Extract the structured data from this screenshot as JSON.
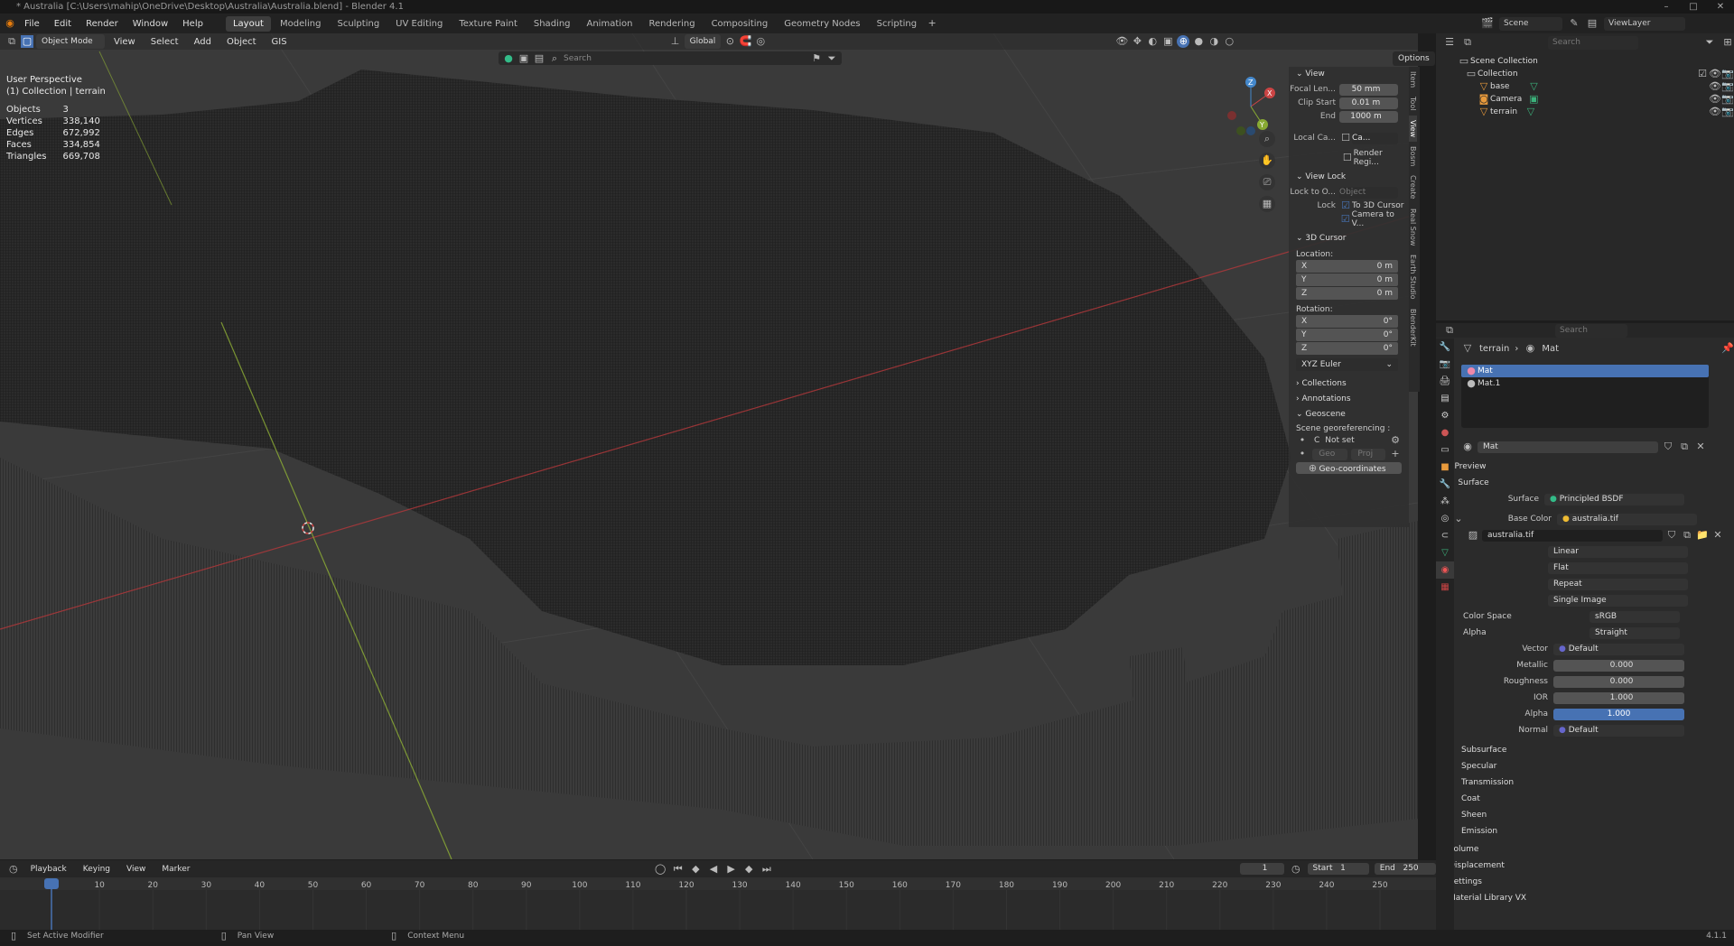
{
  "titlebar": {
    "title": "* Australia [C:\\Users\\mahip\\OneDrive\\Desktop\\Australia\\Australia.blend] - Blender 4.1"
  },
  "menus": [
    "File",
    "Edit",
    "Render",
    "Window",
    "Help"
  ],
  "workspaces": [
    "Layout",
    "Modeling",
    "Sculpting",
    "UV Editing",
    "Texture Paint",
    "Shading",
    "Animation",
    "Rendering",
    "Compositing",
    "Geometry Nodes",
    "Scripting"
  ],
  "topright": {
    "scene": "Scene",
    "viewlayer": "ViewLayer"
  },
  "viewport": {
    "mode": "Object Mode",
    "menus": [
      "View",
      "Select",
      "Add",
      "Object",
      "GIS"
    ],
    "transform": "Global",
    "search_placeholder": "Search",
    "options": "Options",
    "info_line1": "User Perspective",
    "info_line2": "(1) Collection | terrain",
    "stats": [
      {
        "label": "Objects",
        "value": "3"
      },
      {
        "label": "Vertices",
        "value": "338,140"
      },
      {
        "label": "Edges",
        "value": "672,992"
      },
      {
        "label": "Faces",
        "value": "334,854"
      },
      {
        "label": "Triangles",
        "value": "669,708"
      }
    ],
    "gizmo": {
      "x": "X",
      "y": "Y",
      "z": "Z"
    }
  },
  "npanel": {
    "view_header": "View",
    "focal_label": "Focal Len...",
    "focal": "50 mm",
    "clip_start_label": "Clip Start",
    "clip_start": "0.01 m",
    "end_label": "End",
    "end": "1000 m",
    "local_camera_label": "Local Ca...",
    "local_camera_value": "Ca...",
    "render_region": "Render Regi...",
    "viewlock_header": "View Lock",
    "lock_to_label": "Lock to O...",
    "lock_to_placeholder": "Object",
    "lock_label": "Lock",
    "lock_cursor": "To 3D Cursor",
    "lock_camera": "Camera to V...",
    "cursor_header": "3D Cursor",
    "location_label": "Location:",
    "rotation_label": "Rotation:",
    "loc": [
      {
        "axis": "X",
        "value": "0 m"
      },
      {
        "axis": "Y",
        "value": "0 m"
      },
      {
        "axis": "Z",
        "value": "0 m"
      }
    ],
    "rot": [
      {
        "axis": "X",
        "value": "0°"
      },
      {
        "axis": "Y",
        "value": "0°"
      },
      {
        "axis": "Z",
        "value": "0°"
      }
    ],
    "rot_mode": "XYZ Euler",
    "collections": "Collections",
    "annotations": "Annotations",
    "geoscene": "Geoscene",
    "georef_label": "Scene georeferencing :",
    "georef_c": "C",
    "georef_value": "Not set",
    "geo": "Geo",
    "proj": "Proj",
    "geocoords": "Geo-coordinates"
  },
  "vtabs": [
    "Item",
    "Tool",
    "View",
    "Bosm",
    "Create",
    "Real Snow",
    "Earth Studio",
    "BlenderKit"
  ],
  "outliner": {
    "search_placeholder": "Search",
    "root": "Scene Collection",
    "collection": "Collection",
    "items": [
      "base",
      "Camera",
      "terrain"
    ]
  },
  "properties": {
    "search_placeholder": "Search",
    "breadcrumb_obj": "terrain",
    "breadcrumb_mat": "Mat",
    "slots": [
      "Mat",
      "Mat.1"
    ],
    "material_name": "Mat",
    "preview": "Preview",
    "surface_header": "Surface",
    "surface_label": "Surface",
    "surface_value": "Principled BSDF",
    "basecolor_label": "Base Color",
    "basecolor_value": "australia.tif",
    "image_name": "australia.tif",
    "interp": "Linear",
    "proj": "Flat",
    "ext": "Repeat",
    "source": "Single Image",
    "colorspace_label": "Color Space",
    "colorspace": "sRGB",
    "alpha_mode_label": "Alpha",
    "alpha_mode": "Straight",
    "vector_label": "Vector",
    "vector": "Default",
    "metallic_label": "Metallic",
    "metallic": "0.000",
    "roughness_label": "Roughness",
    "roughness": "0.000",
    "ior_label": "IOR",
    "ior": "1.000",
    "alpha_label": "Alpha",
    "alpha": "1.000",
    "alpha_fill": 1.0,
    "normal_label": "Normal",
    "normal": "Default",
    "subsections": [
      "Subsurface",
      "Specular",
      "Transmission",
      "Coat",
      "Sheen",
      "Emission"
    ],
    "sections": [
      "Volume",
      "Displacement",
      "Settings",
      "Material Library VX"
    ]
  },
  "timeline": {
    "menus": [
      "Playback",
      "Keying",
      "View",
      "Marker"
    ],
    "current": "1",
    "start_label": "Start",
    "start": "1",
    "end_label": "End",
    "end": "250",
    "ticks": [
      "1",
      "10",
      "20",
      "30",
      "40",
      "50",
      "60",
      "70",
      "80",
      "90",
      "100",
      "110",
      "120",
      "130",
      "140",
      "150",
      "160",
      "170",
      "180",
      "190",
      "200",
      "210",
      "220",
      "230",
      "240",
      "250"
    ]
  },
  "status": {
    "left": "Set Active Modifier",
    "mid": "Pan View",
    "right": "Context Menu",
    "version": "4.1.1"
  },
  "colors": {
    "accent": "#4772b3",
    "x_axis": "#b5383b",
    "y_axis": "#7a9a2a",
    "z_axis": "#3f7fd0"
  }
}
